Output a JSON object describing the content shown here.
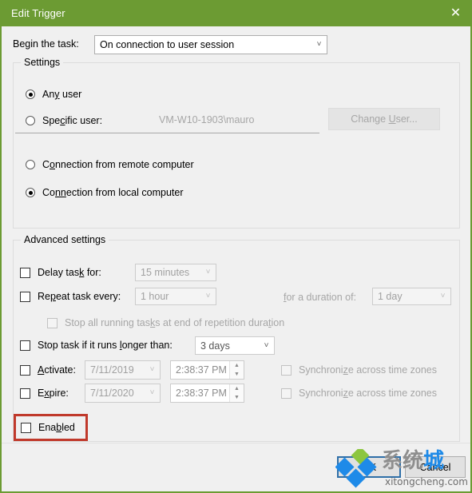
{
  "window": {
    "title": "Edit Trigger",
    "close_icon": "close-icon",
    "titlebar_color": "#6c9b33"
  },
  "begin": {
    "label": "Begin the task:",
    "combo_value": "On connection to user session",
    "arrow_icon": "chevron-down-icon"
  },
  "settings": {
    "legend": "Settings",
    "any_user": {
      "label": "Any user",
      "checked": true
    },
    "specific_user": {
      "label": "Specific user:",
      "checked": false,
      "value": "VM-W10-1903\\mauro"
    },
    "change_user_button": {
      "label": "Change User...",
      "enabled": false
    },
    "connection_remote": {
      "label": "Connection from remote computer",
      "checked": false
    },
    "connection_local": {
      "label": "Connection from local computer",
      "checked": true
    }
  },
  "advanced": {
    "legend": "Advanced settings",
    "delay_task": {
      "label": "Delay task for:",
      "checked": false,
      "value": "15 minutes",
      "enabled": false
    },
    "repeat_task": {
      "label": "Repeat task every:",
      "checked": false,
      "value": "1 hour",
      "enabled": false
    },
    "duration": {
      "label": "for a duration of:",
      "value": "1 day",
      "enabled": false
    },
    "stop_all_running": {
      "label": "Stop all running tasks at end of repetition duration",
      "checked": false,
      "enabled": false
    },
    "stop_task_longer": {
      "label": "Stop task if it runs longer than:",
      "checked": false,
      "value": "3 days",
      "enabled": true
    },
    "activate": {
      "label": "Activate:",
      "checked": false,
      "date": "7/11/2019",
      "time": "2:38:37 PM",
      "sync_label": "Synchronize across time zones",
      "sync_checked": false
    },
    "expire": {
      "label": "Expire:",
      "checked": false,
      "date": "7/11/2020",
      "time": "2:38:37 PM",
      "sync_label": "Synchronize across time zones",
      "sync_checked": false
    },
    "enabled": {
      "label": "Enabled",
      "checked": false,
      "highlight_color": "#c0392b"
    }
  },
  "footer": {
    "ok_label": "OK",
    "cancel_label": "Cancel"
  },
  "watermark": {
    "cn_text_gray": "系统",
    "cn_text_blue": "城",
    "url": "xitongcheng.com"
  }
}
